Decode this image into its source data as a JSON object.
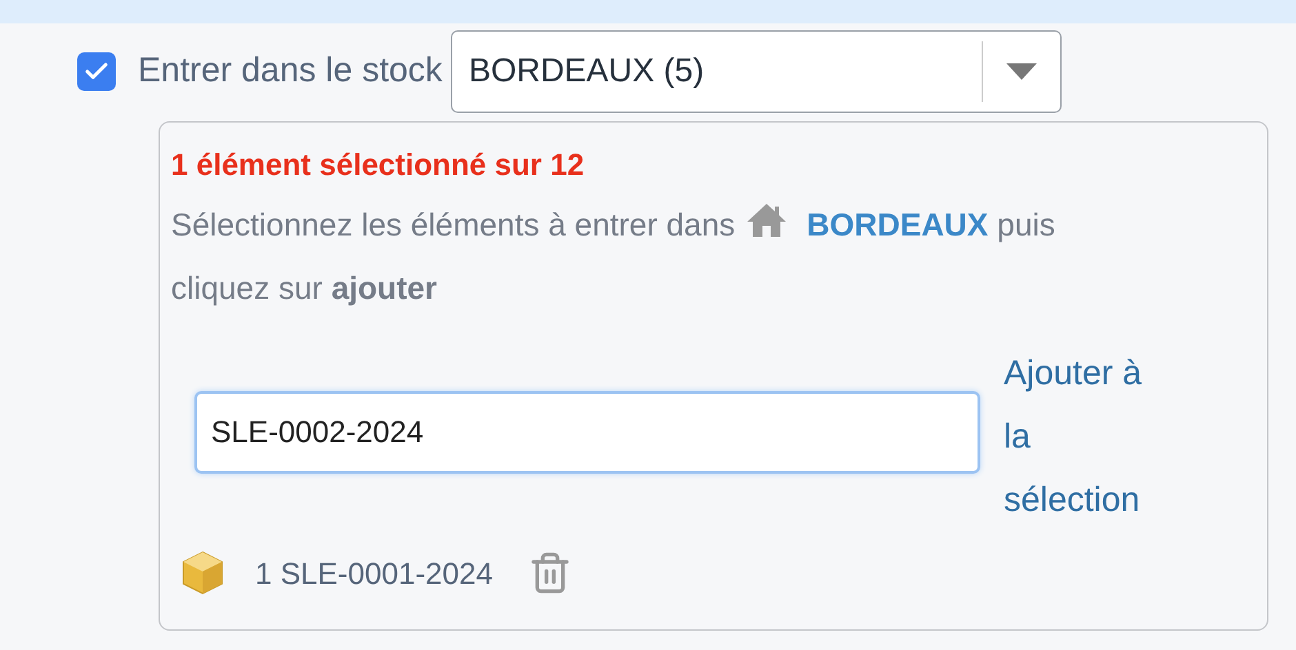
{
  "stock_entry": {
    "label": "Entrer dans le stock",
    "checked": true
  },
  "store_select": {
    "value": "BORDEAUX (5)"
  },
  "panel": {
    "selection_count": "1 élément sélectionné sur 12",
    "instruction": {
      "before": "Sélectionnez les éléments à entrer dans",
      "store": "BORDEAUX",
      "after": "puis",
      "next_line": "cliquez sur **ajouter**"
    },
    "search": {
      "value": "SLE-0002-2024"
    },
    "add_link": "Ajouter à la sélection",
    "items": [
      {
        "label": "1 SLE-0001-2024"
      }
    ]
  }
}
